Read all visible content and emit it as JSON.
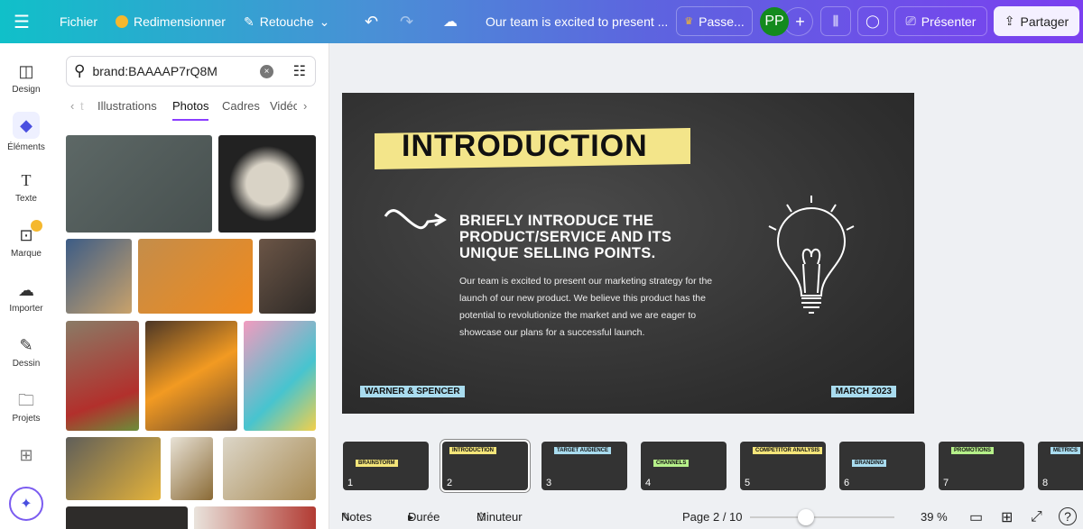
{
  "topbar": {
    "menu_icon": "hamburger-icon",
    "file": "Fichier",
    "resize": "Redimensionner",
    "retouch": "Retouche",
    "doc_title": "Our team is excited to present ...",
    "upgrade": "Passe...",
    "avatar": "PP",
    "present": "Présenter",
    "share": "Partager"
  },
  "sidebar": {
    "items": [
      {
        "label": "Design",
        "icon": "layout-icon"
      },
      {
        "label": "Éléments",
        "icon": "shapes-icon"
      },
      {
        "label": "Texte",
        "icon": "text-icon"
      },
      {
        "label": "Marque",
        "icon": "brand-icon"
      },
      {
        "label": "Importer",
        "icon": "upload-cloud-icon"
      },
      {
        "label": "Dessin",
        "icon": "draw-icon"
      },
      {
        "label": "Projets",
        "icon": "folder-icon"
      }
    ]
  },
  "panel": {
    "search_value": "brand:BAAAAP7rQ8M",
    "tabs": [
      "Illustrations",
      "Photos",
      "Cadres",
      "Vidéo"
    ],
    "active_tab": "Photos",
    "tabs_prev_partial": "t"
  },
  "slide": {
    "title": "INTRODUCTION",
    "heading": "BRIEFLY INTRODUCE THE PRODUCT/SERVICE AND ITS UNIQUE SELLING POINTS.",
    "body": "Our team is excited to present our marketing strategy for the launch of our new product. We believe this product has the potential to revolutionize the market and we are eager to showcase our plans for a successful launch.",
    "footer_left": "WARNER & SPENCER",
    "footer_right": "MARCH 2023"
  },
  "thumbnails": [
    {
      "n": "1",
      "label": "BRAINSTORM",
      "color": "#f4e57a"
    },
    {
      "n": "2",
      "label": "INTRODUCTION",
      "color": "#f4e57a"
    },
    {
      "n": "3",
      "label": "TARGET AUDIENCE",
      "color": "#a9dcef"
    },
    {
      "n": "4",
      "label": "CHANNELS",
      "color": "#b6f08a"
    },
    {
      "n": "5",
      "label": "COMPETITOR ANALYSIS",
      "color": "#f4e57a"
    },
    {
      "n": "6",
      "label": "BRANDING",
      "color": "#a9dcef"
    },
    {
      "n": "7",
      "label": "PROMOTIONS",
      "color": "#b6f08a"
    },
    {
      "n": "8",
      "label": "METRICS",
      "color": "#a9dcef"
    }
  ],
  "bottombar": {
    "notes": "Notes",
    "duration": "Durée",
    "timer": "Minuteur",
    "page": "Page 2 / 10",
    "zoom": "39 %",
    "zoom_fraction": 0.39
  }
}
